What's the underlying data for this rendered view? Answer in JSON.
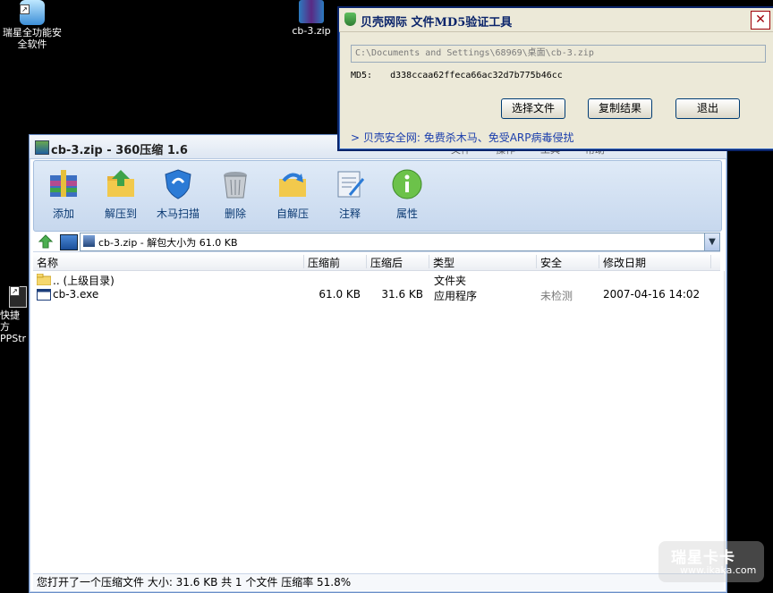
{
  "desktop": {
    "icon1_label": "瑞星全功能安\n全软件",
    "icon2_label": "cb-3.zip",
    "icon3_label": "快捷方\nPPStr"
  },
  "zip": {
    "title": "cb-3.zip - 360压缩 1.6",
    "menus": [
      "文件",
      "操作",
      "工具",
      "帮助"
    ],
    "toolbar": [
      "添加",
      "解压到",
      "木马扫描",
      "删除",
      "自解压",
      "注释",
      "属性"
    ],
    "address": "cb-3.zip - 解包大小为 61.0 KB",
    "columns": [
      "名称",
      "压缩前",
      "压缩后",
      "类型",
      "安全",
      "修改日期"
    ],
    "rows": [
      {
        "name": ".. (上级目录)",
        "before": "",
        "after": "",
        "type": "文件夹",
        "security": "",
        "date": ""
      },
      {
        "name": "cb-3.exe",
        "before": "61.0 KB",
        "after": "31.6 KB",
        "type": "应用程序",
        "security": "未检测",
        "date": "2007-04-16 14:02"
      }
    ],
    "status": "您打开了一个压缩文件 大小: 31.6 KB 共 1 个文件 压缩率 51.8%"
  },
  "md5": {
    "title": "贝壳网际  文件MD5验证工具",
    "path": "C:\\Documents and Settings\\68969\\桌面\\cb-3.zip",
    "md5_label": "MD5:",
    "md5_value": "d338ccaa62ffeca66ac32d7b775b46cc",
    "buttons": [
      "选择文件",
      "复制结果",
      "退出"
    ],
    "link": "> 贝壳安全网: 免费杀木马、免受ARP病毒侵扰",
    "close_label": "✕"
  },
  "watermark": {
    "line1": "瑞星卡卡",
    "line2": "www.ikaka.com"
  },
  "colors": {
    "accent": "#0b3a73",
    "link": "#1a3dac"
  }
}
